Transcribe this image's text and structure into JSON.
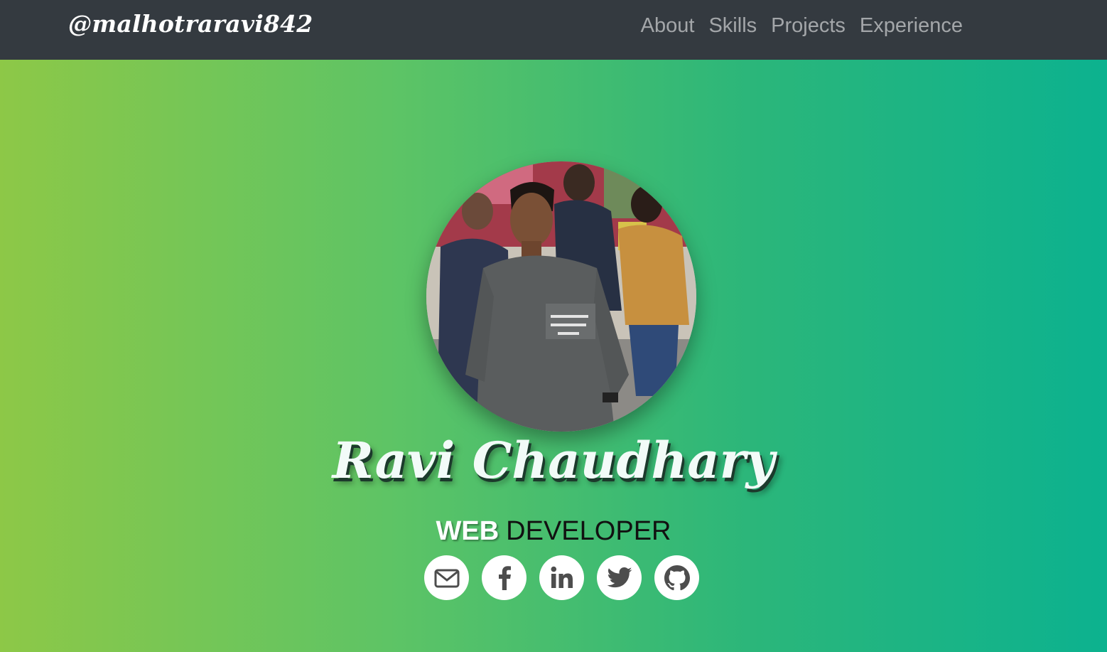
{
  "navbar": {
    "brand": "@malhotraravi842",
    "links": [
      "About",
      "Skills",
      "Projects",
      "Experience"
    ]
  },
  "hero": {
    "name": "Ravi Chaudhary",
    "role_primary": "WEB",
    "role_secondary": "DEVELOPER"
  },
  "socials": [
    {
      "icon": "envelope-icon"
    },
    {
      "icon": "facebook-icon"
    },
    {
      "icon": "linkedin-icon"
    },
    {
      "icon": "twitter-icon"
    },
    {
      "icon": "github-icon"
    }
  ],
  "colors": {
    "navbar_bg": "#343a40",
    "gradient_start": "#8dc847",
    "gradient_end": "#0cb28f",
    "icon_color": "#4d4d4d"
  }
}
